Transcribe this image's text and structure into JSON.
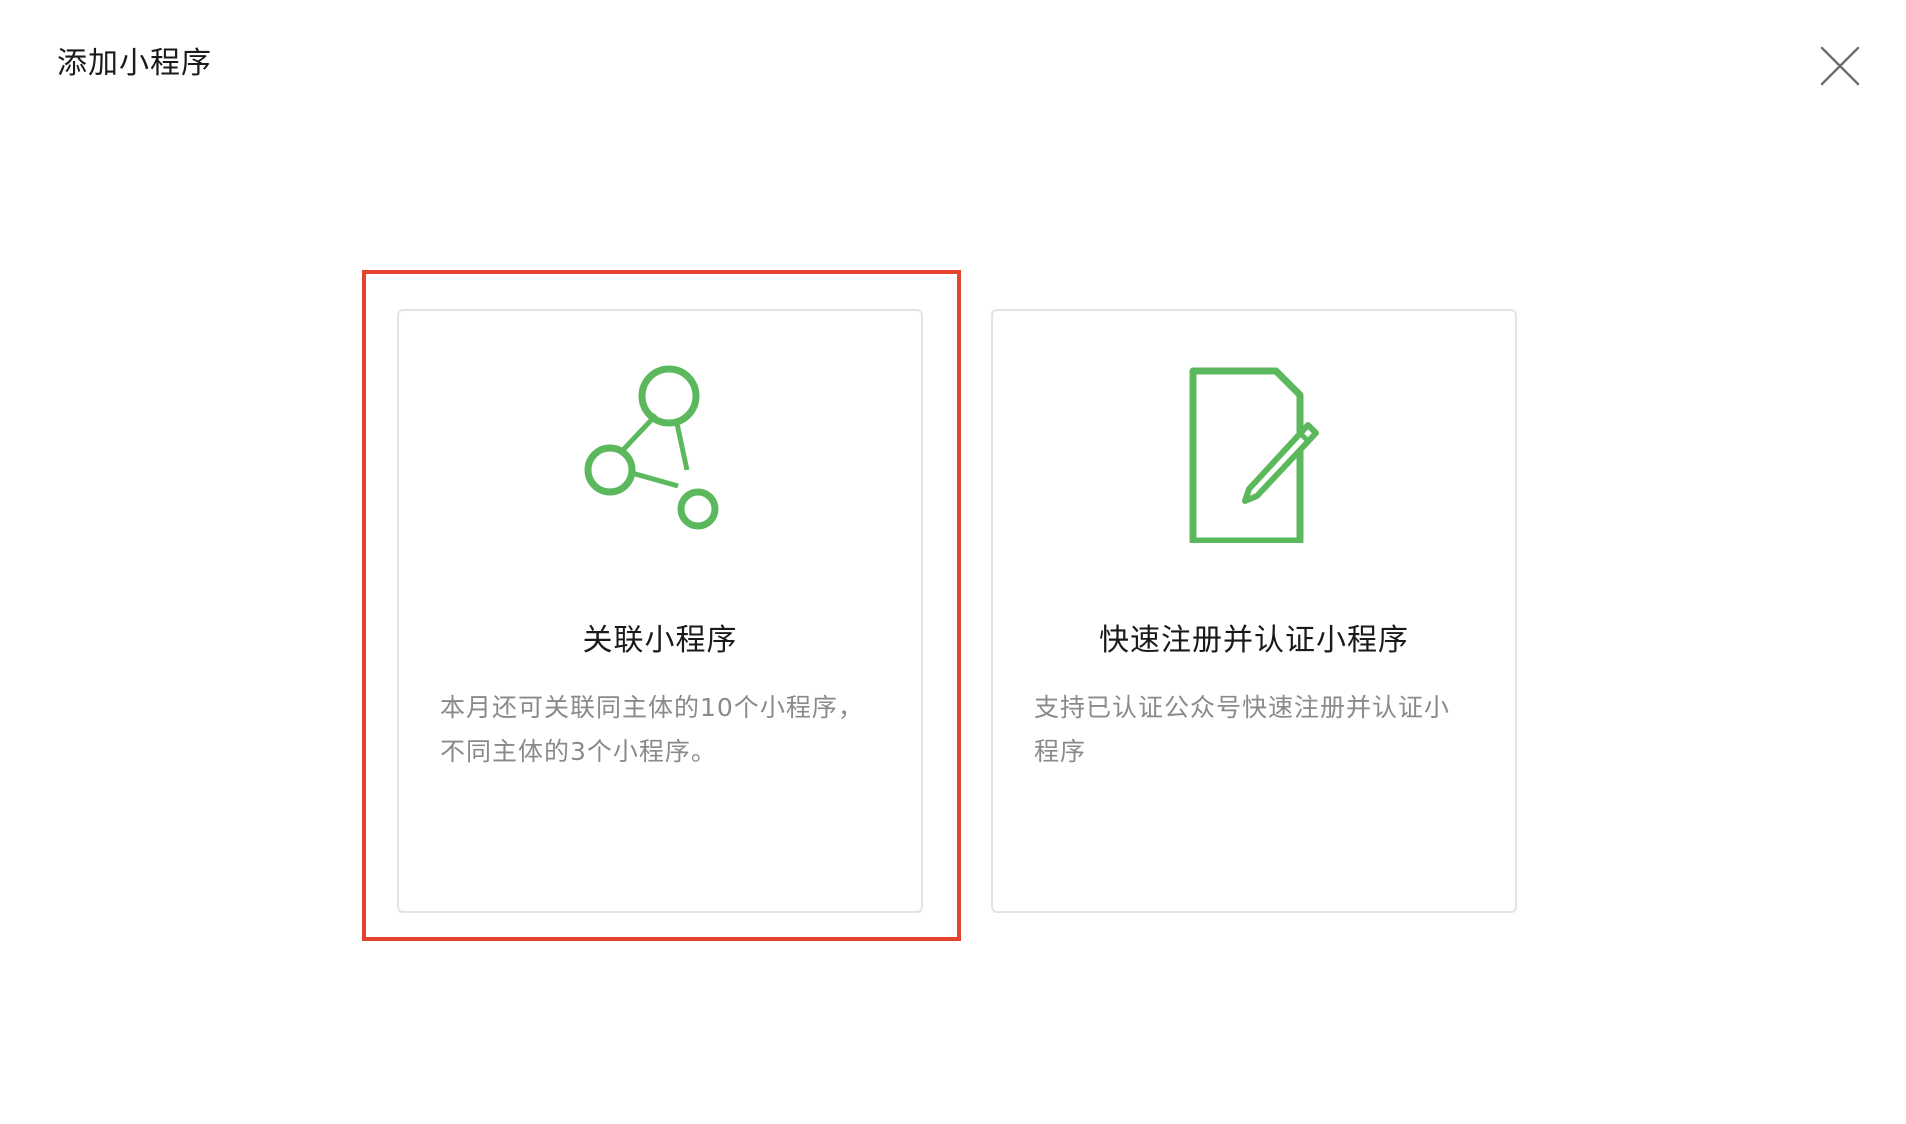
{
  "dialog": {
    "title": "添加小程序"
  },
  "cards": [
    {
      "title": "关联小程序",
      "description": "本月还可关联同主体的10个小程序，不同主体的3个小程序。",
      "icon": "network-link-icon"
    },
    {
      "title": "快速注册并认证小程序",
      "description": "支持已认证公众号快速注册并认证小程序",
      "icon": "document-edit-icon"
    }
  ],
  "colors": {
    "accent_green": "#5cb85c",
    "highlight_red": "#e4432d",
    "card_border": "#e3e3e3",
    "text_secondary": "#8a8a8a"
  }
}
